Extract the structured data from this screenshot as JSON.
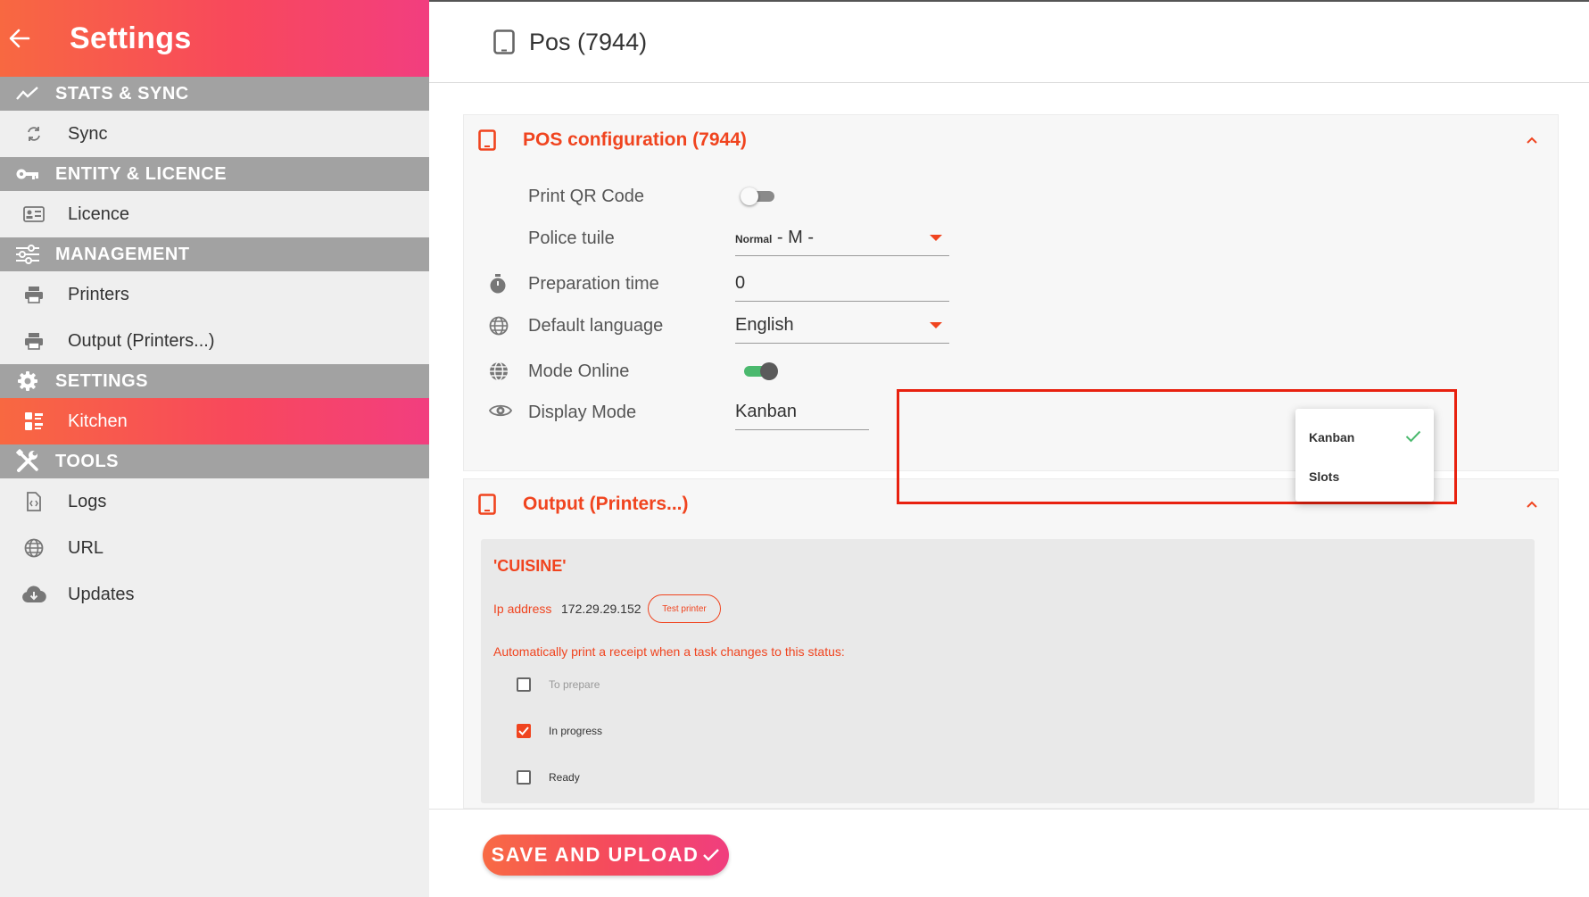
{
  "sidebar": {
    "title": "Settings",
    "sections": [
      {
        "label": "STATS & SYNC",
        "icon": "trend-line-icon"
      },
      {
        "label": "ENTITY & LICENCE",
        "icon": "key-icon"
      },
      {
        "label": "MANAGEMENT",
        "icon": "sliders-icon"
      },
      {
        "label": "SETTINGS",
        "icon": "gear-icon"
      },
      {
        "label": "TOOLS",
        "icon": "tools-icon"
      }
    ],
    "items": [
      {
        "label": "Sync",
        "icon": "sync-icon"
      },
      {
        "label": "Licence",
        "icon": "id-card-icon"
      },
      {
        "label": "Printers",
        "icon": "printer-icon"
      },
      {
        "label": "Output (Printers...)",
        "icon": "printer-icon"
      },
      {
        "label": "Kitchen",
        "icon": "kitchen-icon",
        "active": true
      },
      {
        "label": "Logs",
        "icon": "file-code-icon"
      },
      {
        "label": "URL",
        "icon": "globe-icon"
      },
      {
        "label": "Updates",
        "icon": "cloud-download-icon"
      }
    ]
  },
  "header": {
    "title": "Pos (7944)"
  },
  "pos_config": {
    "title": "POS configuration  (7944)",
    "print_qr": {
      "label": "Print QR Code",
      "enabled": false
    },
    "police_tuile": {
      "label": "Police tuile",
      "value_small": "Normal",
      "value_rest": " - M -"
    },
    "preparation_time": {
      "label": "Preparation time",
      "value": "0"
    },
    "default_language": {
      "label": "Default language",
      "value": "English"
    },
    "mode_online": {
      "label": "Mode Online",
      "enabled": true
    },
    "display_mode": {
      "label": "Display Mode",
      "value": "Kanban",
      "options": [
        "Kanban",
        "Slots"
      ],
      "selected": "Kanban"
    }
  },
  "output": {
    "title": "Output (Printers...)",
    "printer": {
      "name": "'CUISINE'",
      "ip_label": "Ip address",
      "ip_value": "172.29.29.152",
      "test_label": "Test printer",
      "auto_print_text": "Automatically print a receipt when a task changes to this status:",
      "statuses": [
        {
          "label": "To prepare",
          "checked": false
        },
        {
          "label": "In progress",
          "checked": true
        },
        {
          "label": "Ready",
          "checked": false
        }
      ]
    }
  },
  "footer": {
    "save_label": "SAVE AND UPLOAD"
  },
  "colors": {
    "accent": "#f0441f",
    "gradient_start": "#f86841",
    "gradient_end": "#f23e7f",
    "toggle_on": "#4bb96e",
    "highlight": "#e8210f"
  }
}
